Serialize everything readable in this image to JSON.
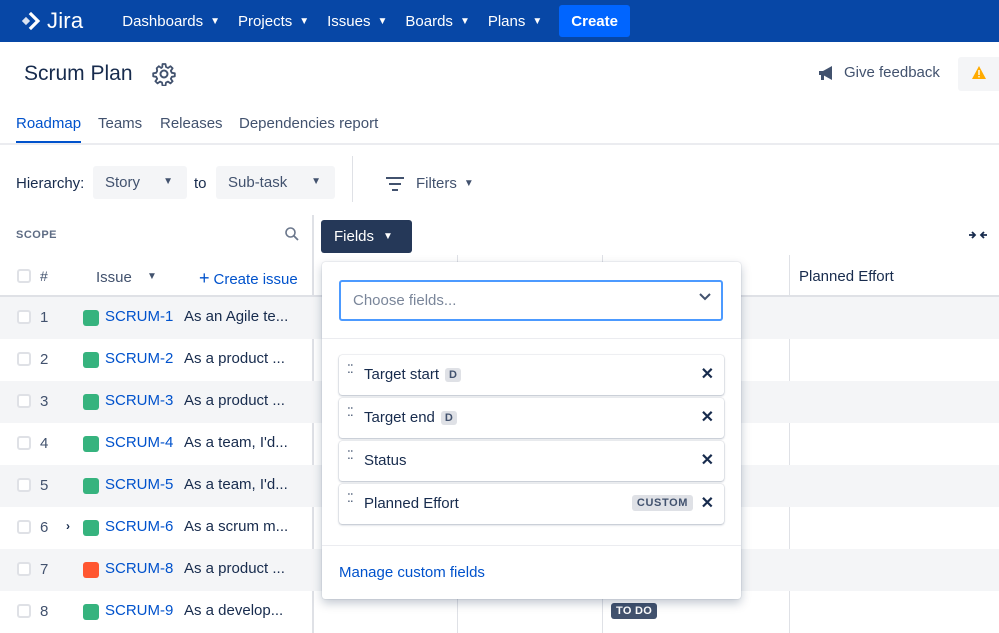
{
  "nav": {
    "logo": "Jira",
    "items": [
      "Dashboards",
      "Projects",
      "Issues",
      "Boards",
      "Plans"
    ],
    "create_label": "Create"
  },
  "header": {
    "title": "Scrum Plan",
    "feedback_label": "Give feedback"
  },
  "tabs": [
    "Roadmap",
    "Teams",
    "Releases",
    "Dependencies report"
  ],
  "hierarchy": {
    "label": "Hierarchy:",
    "from": "Story",
    "to_label": "to",
    "to": "Sub-task",
    "filters_label": "Filters"
  },
  "scope": {
    "label": "SCOPE",
    "hash": "#",
    "issue_label": "Issue",
    "create_issue": "Create issue"
  },
  "fields_button": "Fields",
  "column_headers": {
    "planned_effort": "Planned Effort"
  },
  "rows": [
    {
      "num": "1",
      "key": "SCRUM-1",
      "type": "story",
      "summary": "As an Agile te..."
    },
    {
      "num": "2",
      "key": "SCRUM-2",
      "type": "story",
      "summary": "As a product ..."
    },
    {
      "num": "3",
      "key": "SCRUM-3",
      "type": "story",
      "summary": "As a product ..."
    },
    {
      "num": "4",
      "key": "SCRUM-4",
      "type": "story",
      "summary": "As a team, I'd..."
    },
    {
      "num": "5",
      "key": "SCRUM-5",
      "type": "story",
      "summary": "As a team, I'd..."
    },
    {
      "num": "6",
      "key": "SCRUM-6",
      "type": "story",
      "summary": "As a scrum m...",
      "expandable": true
    },
    {
      "num": "7",
      "key": "SCRUM-8",
      "type": "bug",
      "summary": "As a product ..."
    },
    {
      "num": "8",
      "key": "SCRUM-9",
      "type": "story",
      "summary": "As a develop..."
    }
  ],
  "status_badge": "TO DO",
  "popup": {
    "placeholder": "Choose fields...",
    "fields": [
      {
        "name": "Target start",
        "badge": "D"
      },
      {
        "name": "Target end",
        "badge": "D"
      },
      {
        "name": "Status",
        "badge": ""
      },
      {
        "name": "Planned Effort",
        "badge": "CUSTOM"
      }
    ],
    "manage_label": "Manage custom fields"
  },
  "colors": {
    "nav_bg": "#0747a6",
    "create_bg": "#0065ff",
    "link": "#0052cc",
    "story": "#36b37e",
    "bug": "#ff5630",
    "fields_btn": "#253858"
  }
}
